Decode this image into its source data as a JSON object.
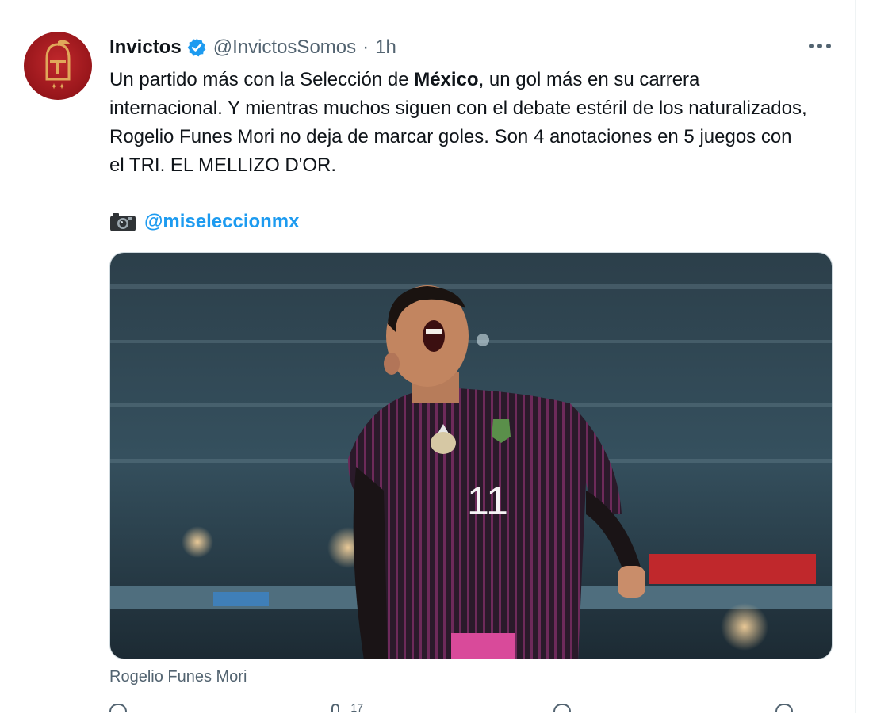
{
  "tweet": {
    "author": {
      "display_name": "Invictos",
      "handle": "@InvictosSomos",
      "separator": "·",
      "time": "1h",
      "verified": true,
      "avatar_icon": "knight-helmet-logo"
    },
    "text": {
      "segment_1": "Un partido más con la Selección de ",
      "bold_1": "México",
      "segment_2": ", un gol más en su carrera internacional. Y mientras muchos siguen con el debate estéril de los naturalizados, Rogelio Funes Mori no deja de marcar goles. Son 4 anotaciones en 5 juegos con el TRI. EL MELLIZO D'OR."
    },
    "photo_credit": {
      "icon": "camera-icon",
      "mention": "@mi­seleccionmx"
    },
    "media": {
      "description_icon": "player-celebration-photo",
      "jersey_number": "11"
    },
    "caption": "Rogelio Funes Mori",
    "actions": [
      {
        "name": "reply",
        "icon": "reply-icon",
        "count": ""
      },
      {
        "name": "retweet",
        "icon": "retweet-icon",
        "count": "17"
      },
      {
        "name": "like",
        "icon": "like-icon",
        "count": ""
      },
      {
        "name": "share",
        "icon": "share-icon",
        "count": ""
      }
    ]
  },
  "colors": {
    "link": "#1d9bf0",
    "text": "#0f1419",
    "secondary": "#536471",
    "avatar_red": "#9a171c",
    "jersey": "#2a1a2a"
  }
}
